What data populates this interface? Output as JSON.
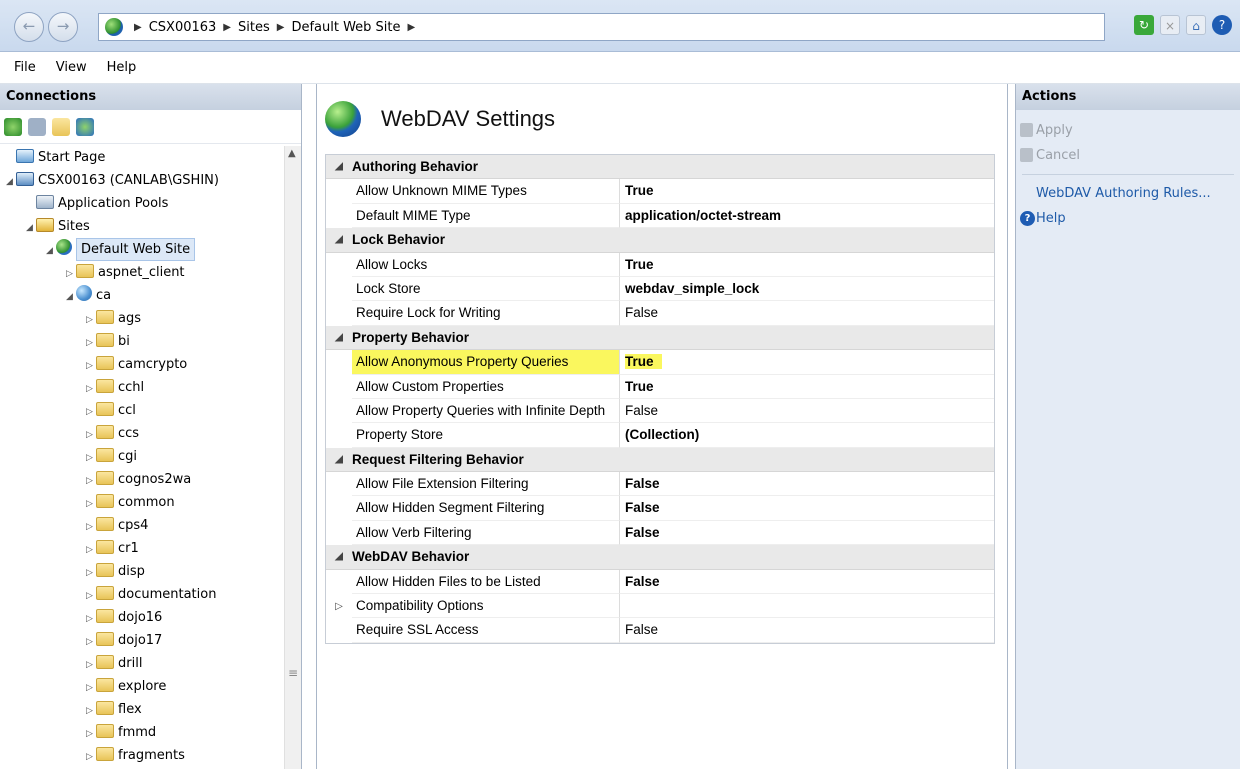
{
  "address": {
    "breadcrumbs": [
      "CSX00163",
      "Sites",
      "Default Web Site"
    ]
  },
  "menu": [
    "File",
    "View",
    "Help"
  ],
  "connections": {
    "title": "Connections",
    "tree": [
      {
        "label": "Start Page",
        "icon": "start-page-icon",
        "depth": 0
      },
      {
        "label": "CSX00163 (CANLAB\\GSHIN)",
        "icon": "server-icon",
        "depth": 0,
        "expanded": true
      },
      {
        "label": "Application Pools",
        "icon": "app-pools-icon",
        "depth": 1
      },
      {
        "label": "Sites",
        "icon": "sites-icon",
        "depth": 1,
        "expanded": true
      },
      {
        "label": "Default Web Site",
        "icon": "website-globe-icon",
        "depth": 2,
        "expanded": true,
        "selected": true
      },
      {
        "label": "aspnet_client",
        "icon": "folder-icon",
        "depth": 3,
        "collapsed": true
      },
      {
        "label": "ca",
        "icon": "application-icon",
        "depth": 3,
        "expanded": true
      },
      {
        "label": "ags",
        "icon": "folder-icon",
        "depth": 4
      },
      {
        "label": "bi",
        "icon": "folder-icon",
        "depth": 4
      },
      {
        "label": "camcrypto",
        "icon": "folder-icon",
        "depth": 4
      },
      {
        "label": "cchl",
        "icon": "folder-icon",
        "depth": 4
      },
      {
        "label": "ccl",
        "icon": "folder-icon",
        "depth": 4
      },
      {
        "label": "ccs",
        "icon": "folder-icon",
        "depth": 4
      },
      {
        "label": "cgi",
        "icon": "folder-icon",
        "depth": 4
      },
      {
        "label": "cognos2wa",
        "icon": "folder-icon",
        "depth": 4
      },
      {
        "label": "common",
        "icon": "folder-icon",
        "depth": 4
      },
      {
        "label": "cps4",
        "icon": "folder-icon",
        "depth": 4
      },
      {
        "label": "cr1",
        "icon": "folder-icon",
        "depth": 4
      },
      {
        "label": "disp",
        "icon": "folder-icon",
        "depth": 4
      },
      {
        "label": "documentation",
        "icon": "folder-icon",
        "depth": 4
      },
      {
        "label": "dojo16",
        "icon": "folder-icon",
        "depth": 4
      },
      {
        "label": "dojo17",
        "icon": "folder-icon",
        "depth": 4
      },
      {
        "label": "drill",
        "icon": "folder-icon",
        "depth": 4
      },
      {
        "label": "explore",
        "icon": "folder-icon",
        "depth": 4
      },
      {
        "label": "flex",
        "icon": "folder-icon",
        "depth": 4
      },
      {
        "label": "fmmd",
        "icon": "folder-icon",
        "depth": 4
      },
      {
        "label": "fragments",
        "icon": "folder-icon",
        "depth": 4
      }
    ]
  },
  "main": {
    "title": "WebDAV Settings",
    "grid": [
      {
        "type": "category",
        "label": "Authoring Behavior"
      },
      {
        "type": "prop",
        "name": "Allow Unknown MIME Types",
        "value": "True",
        "bold": true
      },
      {
        "type": "prop",
        "name": "Default MIME Type",
        "value": "application/octet-stream",
        "bold": true
      },
      {
        "type": "category",
        "label": "Lock Behavior"
      },
      {
        "type": "prop",
        "name": "Allow Locks",
        "value": "True",
        "bold": true
      },
      {
        "type": "prop",
        "name": "Lock Store",
        "value": "webdav_simple_lock",
        "bold": true
      },
      {
        "type": "prop",
        "name": "Require Lock for Writing",
        "value": "False",
        "bold": false
      },
      {
        "type": "category",
        "label": "Property Behavior"
      },
      {
        "type": "prop",
        "name": "Allow Anonymous Property Queries",
        "value": "True",
        "bold": true,
        "highlight": true
      },
      {
        "type": "prop",
        "name": "Allow Custom Properties",
        "value": "True",
        "bold": true
      },
      {
        "type": "prop",
        "name": "Allow Property Queries with Infinite Depth",
        "value": "False",
        "bold": false
      },
      {
        "type": "prop",
        "name": "Property Store",
        "value": "(Collection)",
        "bold": true
      },
      {
        "type": "category",
        "label": "Request Filtering Behavior"
      },
      {
        "type": "prop",
        "name": "Allow File Extension Filtering",
        "value": "False",
        "bold": true
      },
      {
        "type": "prop",
        "name": "Allow Hidden Segment Filtering",
        "value": "False",
        "bold": true
      },
      {
        "type": "prop",
        "name": "Allow Verb Filtering",
        "value": "False",
        "bold": true
      },
      {
        "type": "category",
        "label": "WebDAV Behavior"
      },
      {
        "type": "prop",
        "name": "Allow Hidden Files to be Listed",
        "value": "False",
        "bold": true
      },
      {
        "type": "prop",
        "name": "Compatibility Options",
        "value": "",
        "bold": false,
        "expandable": true
      },
      {
        "type": "prop",
        "name": "Require SSL Access",
        "value": "False",
        "bold": false
      }
    ]
  },
  "actions": {
    "title": "Actions",
    "apply": "Apply",
    "cancel": "Cancel",
    "authoring_rules": "WebDAV Authoring Rules...",
    "help": "Help"
  },
  "colors": {
    "highlight": "#faf75e",
    "link": "#1e5aa8"
  }
}
